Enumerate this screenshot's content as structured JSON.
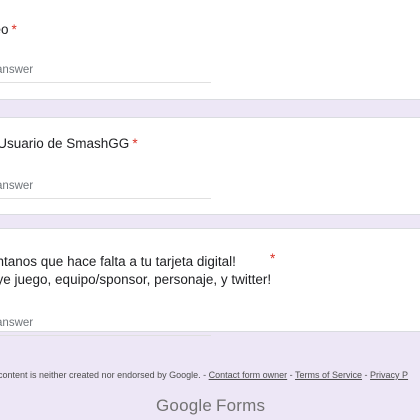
{
  "questions": [
    {
      "title_line1": "reo",
      "title_line2": "",
      "required_mark": "*",
      "placeholder": "r answer"
    },
    {
      "title_line1": "- Usuario de SmashGG",
      "title_line2": "",
      "required_mark": "*",
      "placeholder": "r answer"
    },
    {
      "title_line1": "éntanos que hace falta a tu tarjeta digital!",
      "title_line2": "uye juego, equipo/sponsor, personaje, y twitter!",
      "required_mark": "*",
      "placeholder": "r answer"
    }
  ],
  "footer": {
    "disclaimer": "content is neither created nor endorsed by Google. - ",
    "link_contact": "Contact form owner",
    "sep1": " - ",
    "link_terms": "Terms of Service",
    "sep2": " - ",
    "link_privacy": "Privacy P"
  },
  "logo": {
    "google": "Google",
    "forms": "Forms"
  },
  "colors": {
    "background": "#ede7f6",
    "required": "#d93025",
    "card": "#ffffff"
  }
}
